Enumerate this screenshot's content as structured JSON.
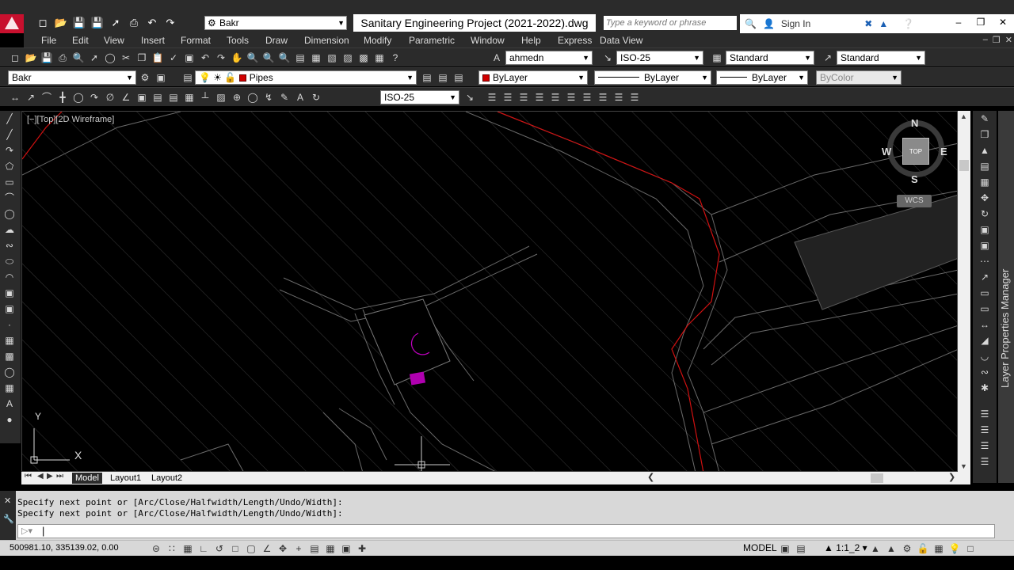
{
  "titlebar": {
    "workspace": "Bakr",
    "document_title": "Sanitary Engineering Project (2021-2022).dwg",
    "search_placeholder": "Type a keyword or phrase",
    "sign_in": "Sign In"
  },
  "menubar": {
    "items": [
      "File",
      "Edit",
      "View",
      "Insert",
      "Format",
      "Tools",
      "Draw",
      "Dimension",
      "Modify",
      "Parametric",
      "Window",
      "Help",
      "Express",
      "Data View"
    ]
  },
  "toolbar1": {
    "text_style": "ahmedn",
    "dim_style": "ISO-25",
    "table_style": "Standard",
    "mleader_style": "Standard"
  },
  "toolbar2": {
    "workspace": "Bakr",
    "layer": "Pipes",
    "layer_color": "#d00000",
    "color": "ByLayer",
    "linetype": "ByLayer",
    "lineweight": "ByLayer",
    "plot_style": "ByColor"
  },
  "toolbar3": {
    "dim_style": "ISO-25"
  },
  "viewport": {
    "label": "[−][Top][2D Wireframe]",
    "compass": {
      "n": "N",
      "s": "S",
      "e": "E",
      "w": "W"
    },
    "cube_face": "TOP",
    "wcs": "WCS",
    "ucs_x": "X",
    "ucs_y": "Y"
  },
  "palette": {
    "label": "Layer Properties Manager"
  },
  "layout_tabs": [
    "Model",
    "Layout1",
    "Layout2"
  ],
  "command": {
    "history": [
      "Specify next point or [Arc/Close/Halfwidth/Length/Undo/Width]:",
      "Specify next point or [Arc/Close/Halfwidth/Length/Undo/Width]:"
    ]
  },
  "statusbar": {
    "coordinates": "500981.10, 335139.02, 0.00",
    "model": "MODEL",
    "annotation_scale": "1:1_2"
  }
}
